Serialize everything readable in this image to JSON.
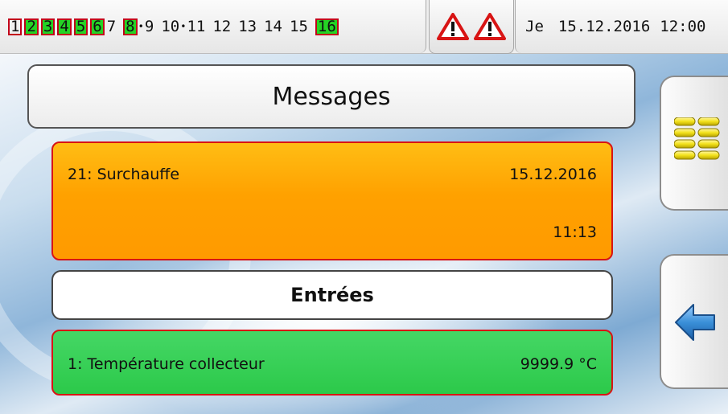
{
  "status_bar": {
    "outputs": [
      {
        "label": "1",
        "state": "boxed"
      },
      {
        "label": "2",
        "state": "on"
      },
      {
        "label": "3",
        "state": "on"
      },
      {
        "label": "4",
        "state": "on"
      },
      {
        "label": "5",
        "state": "on"
      },
      {
        "label": "6",
        "state": "on"
      },
      {
        "label": "7",
        "state": "off"
      },
      {
        "label": "8",
        "state": "on"
      },
      {
        "label": "9",
        "state": "off"
      },
      {
        "label": "10",
        "state": "off"
      },
      {
        "label": "11",
        "state": "off"
      },
      {
        "label": "12",
        "state": "off"
      },
      {
        "label": "13",
        "state": "off"
      },
      {
        "label": "14",
        "state": "off"
      },
      {
        "label": "15",
        "state": "off"
      },
      {
        "label": "16",
        "state": "on"
      }
    ],
    "alarm_icons": [
      "warning-icon",
      "warning-icon"
    ],
    "day": "Je",
    "date": "15.12.2016",
    "time": "12:00"
  },
  "page": {
    "title": "Messages"
  },
  "message": {
    "name": "21: Surchauffe",
    "date": "15.12.2016",
    "time": "11:13"
  },
  "section": {
    "title": "Entrées"
  },
  "input": {
    "name": "1: Température collecteur",
    "value": "9999.9 °C"
  },
  "side_buttons": {
    "menu_icon": "menu-grid-icon",
    "back_icon": "back-arrow-icon"
  },
  "colors": {
    "output_on": "#25d325",
    "output_frame": "#c2001a",
    "message_bg": "#ffa100",
    "input_bg": "#2cc94a",
    "alert_border": "#d81414",
    "accent_blue": "#3a8fd8"
  }
}
